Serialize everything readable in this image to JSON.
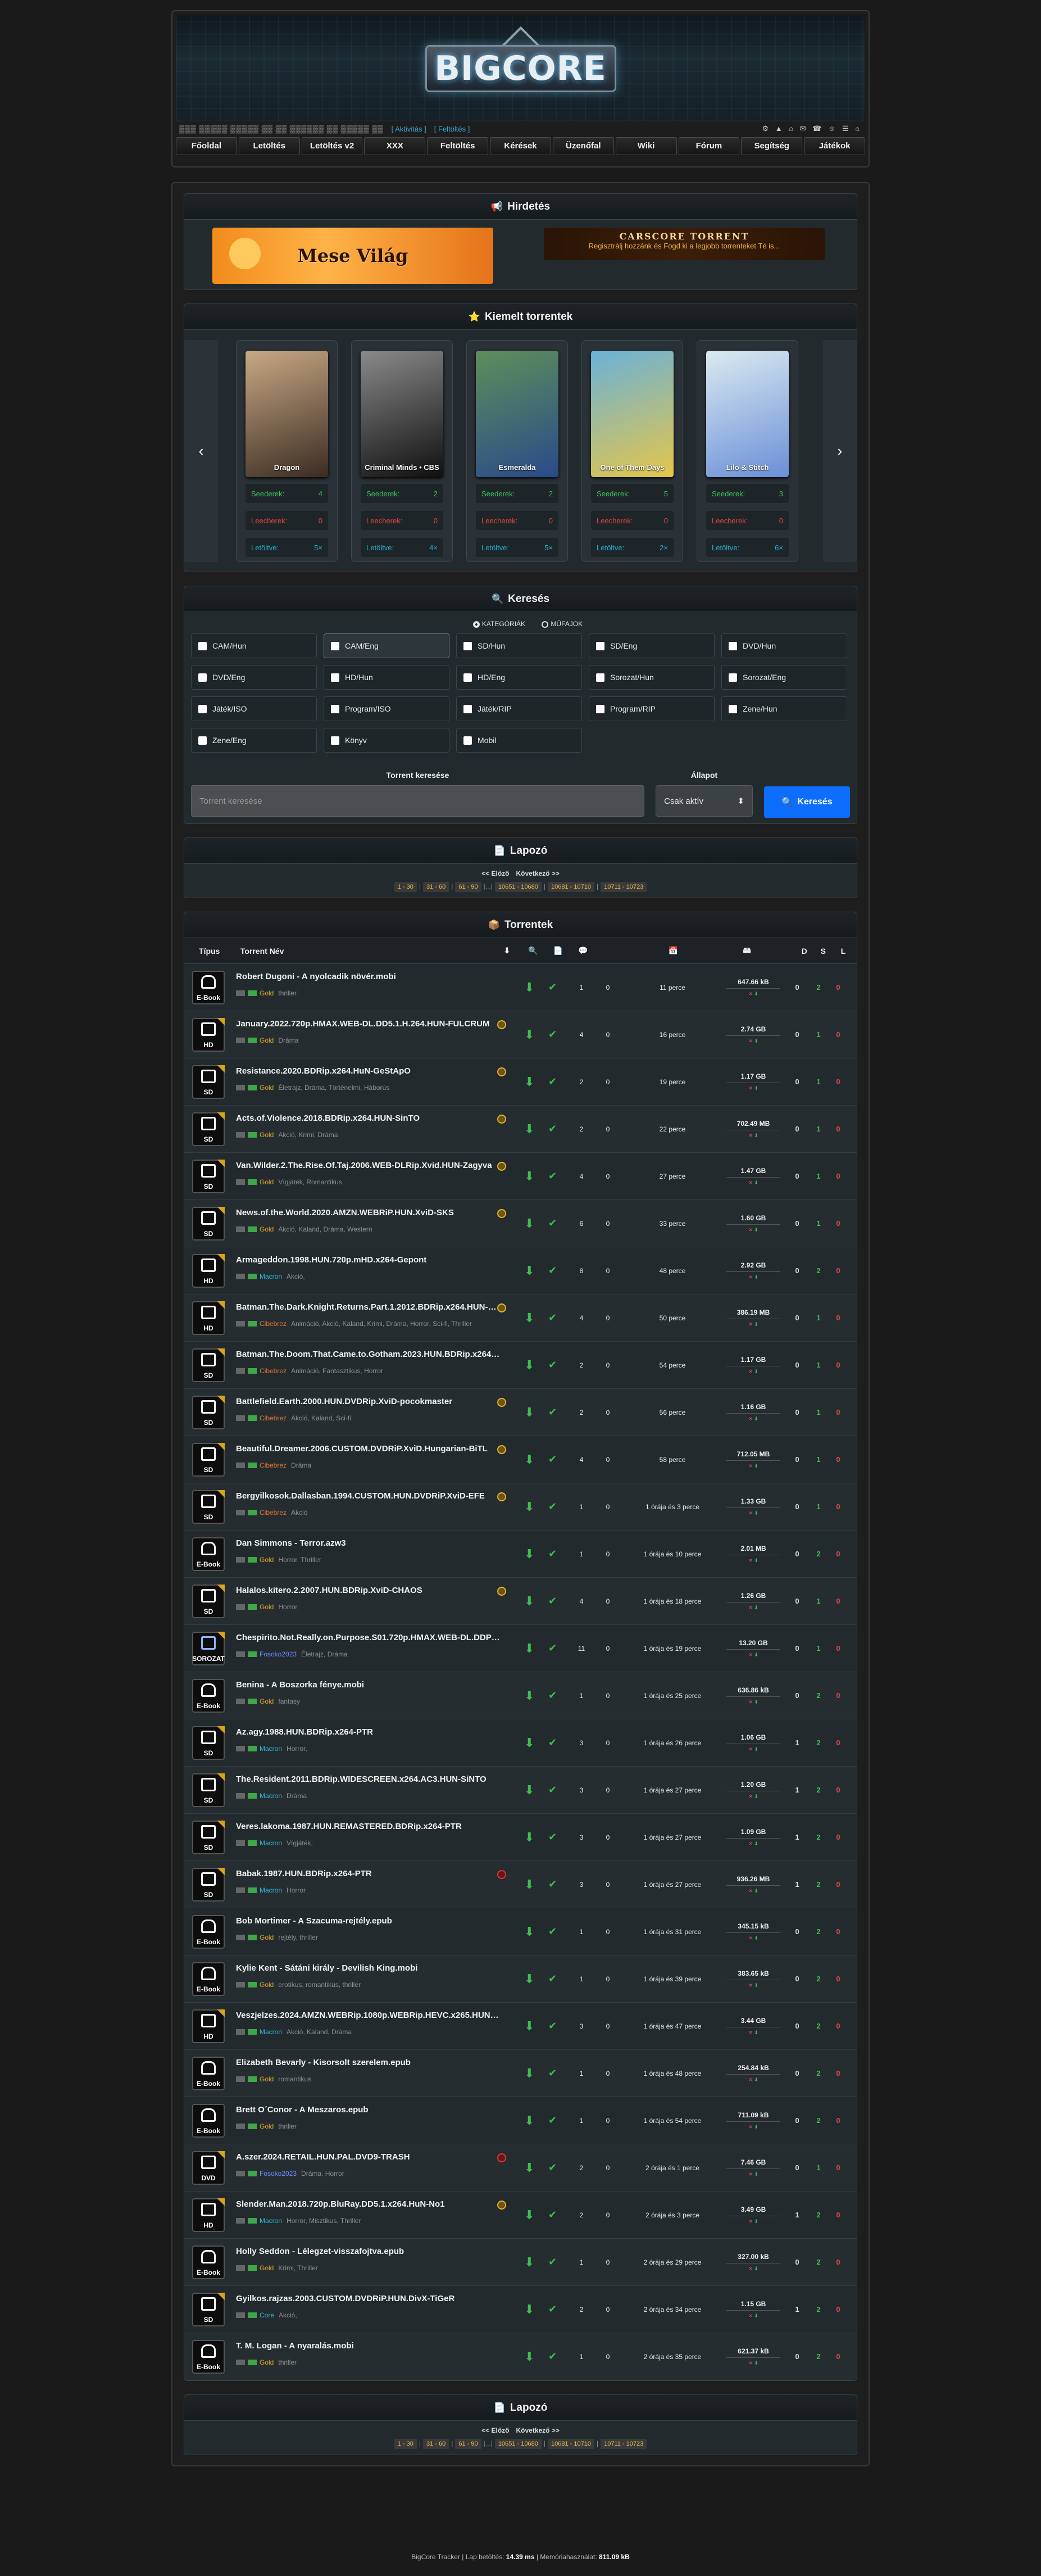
{
  "site": {
    "logo": "BIGCORE",
    "username": "▒▒▒ ▒▒▒▒▒ ▒▒▒▒▒ ▒▒ ▒▒ ▒▒▒▒▒▒ ▒▒ ▒▒▒▒▒ ▒▒",
    "activity_link": "[ Aktivitás ]",
    "topup_link": "[ Feltöltés ]",
    "icons": "⚙ ▲ ⌂ ✉ ☎ ☺ ☰ ⌂"
  },
  "nav": [
    "Főoldal",
    "Letöltés",
    "Letöltés v2",
    "XXX",
    "Feltöltés",
    "Kérések",
    "Üzenőfal",
    "Wiki",
    "Fórum",
    "Segítség",
    "Játékok"
  ],
  "ads": {
    "title": "Hirdetés",
    "ad1": "Mese Világ",
    "ad2_title": "CARSCORE TORRENT",
    "ad2_sub": "Regisztrálj hozzánk és Fogd ki a legjobb torrenteket Té is..."
  },
  "featured": {
    "title": "Kiemelt torrentek",
    "labels": {
      "seed": "Seederek:",
      "leech": "Leecherek:",
      "dl": "Letöltve:"
    },
    "items": [
      {
        "poster": "Dragon",
        "c1": "#c9a985",
        "c2": "#3b2c22",
        "seed": "4",
        "leech": "0",
        "dl": "5×"
      },
      {
        "poster": "Criminal Minds • CBS",
        "c1": "#8a8a8a",
        "c2": "#101010",
        "seed": "2",
        "leech": "0",
        "dl": "4×"
      },
      {
        "poster": "Esmeralda",
        "c1": "#5f8e5a",
        "c2": "#2a4a8a",
        "seed": "2",
        "leech": "0",
        "dl": "5×"
      },
      {
        "poster": "One of Them Days",
        "c1": "#6ab1d9",
        "c2": "#e4c64a",
        "seed": "5",
        "leech": "0",
        "dl": "2×"
      },
      {
        "poster": "Lilo & Stitch",
        "c1": "#dbeaf0",
        "c2": "#6a8fd8",
        "seed": "3",
        "leech": "0",
        "dl": "6×"
      }
    ]
  },
  "search": {
    "title": "Keresés",
    "radio1": "KATEGÓRIÁK",
    "radio2": "MŰFAJOK",
    "categories": [
      "CAM/Hun",
      "CAM/Eng",
      "SD/Hun",
      "SD/Eng",
      "DVD/Hun",
      "DVD/Eng",
      "HD/Hun",
      "HD/Eng",
      "Sorozat/Hun",
      "Sorozat/Eng",
      "Játék/ISO",
      "Program/ISO",
      "Játék/RIP",
      "Program/RIP",
      "Zene/Hun",
      "Zene/Eng",
      "Könyv",
      "Mobil"
    ],
    "query_label": "Torrent keresése",
    "query_placeholder": "Torrent keresése",
    "state_label": "Állapot",
    "state_value": "Csak aktív",
    "button": "Keresés"
  },
  "pager": {
    "title": "Lapozó",
    "prev": "<< Előző",
    "next": "Következő >>",
    "pages": [
      "1 - 30",
      "31 - 60",
      "61 - 90",
      "...",
      "10651 - 10680",
      "10681 - 10710",
      "10711 - 10723"
    ]
  },
  "torrents": {
    "title": "Torrentek",
    "col_type": "Típus",
    "col_name": "Torrent Név",
    "col_d": "D",
    "col_s": "S",
    "col_l": "L",
    "rows": [
      {
        "cat": "E-Book",
        "name": "Robert Dugoni - A nyolcadik növér.mobi",
        "uploader": "Gold",
        "uc": "u-gold",
        "genre": "thriller",
        "badge": "",
        "c": "1",
        "m": "0",
        "time": "11 perce",
        "size": "647.66 kB",
        "d": "0",
        "s": "2",
        "l": "0"
      },
      {
        "cat": "HD",
        "name": "January.2022.720p.HMAX.WEB-DL.DD5.1.H.264.HUN-FULCRUM",
        "uploader": "Gold",
        "uc": "u-gold",
        "genre": "Dráma",
        "badge": "y",
        "c": "4",
        "m": "0",
        "time": "16 perce",
        "size": "2.74 GB",
        "d": "0",
        "s": "1",
        "l": "0"
      },
      {
        "cat": "SD",
        "name": "Resistance.2020.BDRip.x264.HuN-GeStApO",
        "uploader": "Gold",
        "uc": "u-gold",
        "genre": "Életrajz, Dráma, Történelmi, Háborús",
        "badge": "y",
        "c": "2",
        "m": "0",
        "time": "19 perce",
        "size": "1.17 GB",
        "d": "0",
        "s": "1",
        "l": "0"
      },
      {
        "cat": "SD",
        "name": "Acts.of.Violence.2018.BDRip.x264.HUN-SinTO",
        "uploader": "Gold",
        "uc": "u-gold",
        "genre": "Akció, Krimi, Dráma",
        "badge": "y",
        "c": "2",
        "m": "0",
        "time": "22 perce",
        "size": "702.49 MB",
        "d": "0",
        "s": "1",
        "l": "0"
      },
      {
        "cat": "SD",
        "name": "Van.Wilder.2.The.Rise.Of.Taj.2006.WEB-DLRip.Xvid.HUN-Zagyva",
        "uploader": "Gold",
        "uc": "u-gold",
        "genre": "Vígjáték, Romantikus",
        "badge": "y",
        "c": "4",
        "m": "0",
        "time": "27 perce",
        "size": "1.47 GB",
        "d": "0",
        "s": "1",
        "l": "0"
      },
      {
        "cat": "SD",
        "name": "News.of.the.World.2020.AMZN.WEBRiP.HUN.XviD-SKS",
        "uploader": "Gold",
        "uc": "u-gold",
        "genre": "Akció, Kaland, Dráma, Western",
        "badge": "y",
        "c": "6",
        "m": "0",
        "time": "33 perce",
        "size": "1.60 GB",
        "d": "0",
        "s": "1",
        "l": "0"
      },
      {
        "cat": "HD",
        "name": "Armageddon.1998.HUN.720p.mHD.x264-Gepont",
        "uploader": "Macron",
        "uc": "u-mac",
        "genre": "Akció,",
        "badge": "",
        "c": "8",
        "m": "0",
        "time": "48 perce",
        "size": "2.92 GB",
        "d": "0",
        "s": "2",
        "l": "0"
      },
      {
        "cat": "HD",
        "name": "Batman.The.Dark.Knight.Returns.Part.1.2012.BDRip.x264.HUN-PROD",
        "uploader": "Cibebrez",
        "uc": "u-cib",
        "genre": "Animáció, Akció, Kaland, Krimi, Dráma, Horror, Sci-fi, Thriller",
        "badge": "y",
        "c": "4",
        "m": "0",
        "time": "50 perce",
        "size": "386.19 MB",
        "d": "0",
        "s": "1",
        "l": "0"
      },
      {
        "cat": "SD",
        "name": "Batman.The.Doom.That.Came.to.Gotham.2023.HUN.BDRip.x264-PROD",
        "uploader": "Cibebrez",
        "uc": "u-cib",
        "genre": "Animáció, Fantasztikus, Horror",
        "badge": "",
        "c": "2",
        "m": "0",
        "time": "54 perce",
        "size": "1.17 GB",
        "d": "0",
        "s": "1",
        "l": "0"
      },
      {
        "cat": "SD",
        "name": "Battlefield.Earth.2000.HUN.DVDRip.XviD-pocokmaster",
        "uploader": "Cibebrez",
        "uc": "u-cib",
        "genre": "Akció, Kaland, Sci-fi",
        "badge": "y",
        "c": "2",
        "m": "0",
        "time": "56 perce",
        "size": "1.16 GB",
        "d": "0",
        "s": "1",
        "l": "0"
      },
      {
        "cat": "SD",
        "name": "Beautiful.Dreamer.2006.CUSTOM.DVDRiP.XviD.Hungarian-BiTL",
        "uploader": "Cibebrez",
        "uc": "u-cib",
        "genre": "Dráma",
        "badge": "y",
        "c": "4",
        "m": "0",
        "time": "58 perce",
        "size": "712.05 MB",
        "d": "0",
        "s": "1",
        "l": "0"
      },
      {
        "cat": "SD",
        "name": "Bergyilkosok.Dallasban.1994.CUSTOM.HUN.DVDRiP.XviD-EFE",
        "uploader": "Cibebrez",
        "uc": "u-cib",
        "genre": "Akció",
        "badge": "y",
        "c": "1",
        "m": "0",
        "time": "1 órája és 3 perce",
        "size": "1.33 GB",
        "d": "0",
        "s": "1",
        "l": "0"
      },
      {
        "cat": "E-Book",
        "name": "Dan Simmons - Terror.azw3",
        "uploader": "Gold",
        "uc": "u-gold",
        "genre": "Horror, Thriller",
        "badge": "",
        "c": "1",
        "m": "0",
        "time": "1 órája és 10 perce",
        "size": "2.01 MB",
        "d": "0",
        "s": "2",
        "l": "0"
      },
      {
        "cat": "SD",
        "name": "Halalos.kitero.2.2007.HUN.BDRip.XviD-CHAOS",
        "uploader": "Gold",
        "uc": "u-gold",
        "genre": "Horror",
        "badge": "y",
        "c": "4",
        "m": "0",
        "time": "1 órája és 18 perce",
        "size": "1.26 GB",
        "d": "0",
        "s": "1",
        "l": "0"
      },
      {
        "cat": "SOROZAT",
        "name": "Chespirito.Not.Really.on.Purpose.S01.720p.HMAX.WEB-DL.DDP5.1",
        "uploader": "Fosoko2023",
        "uc": "u-fel",
        "genre": "Életrajz, Dráma",
        "badge": "",
        "c": "11",
        "m": "0",
        "time": "1 órája és 19 perce",
        "size": "13.20 GB",
        "d": "0",
        "s": "1",
        "l": "0"
      },
      {
        "cat": "E-Book",
        "name": "Benina - A Boszorka fénye.mobi",
        "uploader": "Gold",
        "uc": "u-gold",
        "genre": "fantasy",
        "badge": "",
        "c": "1",
        "m": "0",
        "time": "1 órája és 25 perce",
        "size": "636.86 kB",
        "d": "0",
        "s": "2",
        "l": "0"
      },
      {
        "cat": "SD",
        "name": "Az.agy.1988.HUN.BDRip.x264-PTR",
        "uploader": "Macron",
        "uc": "u-mac",
        "genre": "Horror,",
        "badge": "",
        "c": "3",
        "m": "0",
        "time": "1 órája és 26 perce",
        "size": "1.06 GB",
        "d": "1",
        "s": "2",
        "l": "0"
      },
      {
        "cat": "SD",
        "name": "The.Resident.2011.BDRip.WIDESCREEN.x264.AC3.HUN-SiNTO",
        "uploader": "Macron",
        "uc": "u-mac",
        "genre": "Dráma",
        "badge": "",
        "c": "3",
        "m": "0",
        "time": "1 órája és 27 perce",
        "size": "1.20 GB",
        "d": "1",
        "s": "2",
        "l": "0"
      },
      {
        "cat": "SD",
        "name": "Veres.lakoma.1987.HUN.REMASTERED.BDRip.x264-PTR",
        "uploader": "Macron",
        "uc": "u-mac",
        "genre": "Vígjáték,",
        "badge": "",
        "c": "3",
        "m": "0",
        "time": "1 órája és 27 perce",
        "size": "1.09 GB",
        "d": "1",
        "s": "2",
        "l": "0"
      },
      {
        "cat": "SD",
        "name": "Babak.1987.HUN.BDRip.x264-PTR",
        "uploader": "Macron",
        "uc": "u-mac",
        "genre": "Horror",
        "badge": "r",
        "c": "3",
        "m": "0",
        "time": "1 órája és 27 perce",
        "size": "936.26 MB",
        "d": "1",
        "s": "2",
        "l": "0"
      },
      {
        "cat": "E-Book",
        "name": "Bob Mortimer - A Szacuma-rejtély.epub",
        "uploader": "Gold",
        "uc": "u-gold",
        "genre": "rejtély, thriller",
        "badge": "",
        "c": "1",
        "m": "0",
        "time": "1 órája és 31 perce",
        "size": "345.15 kB",
        "d": "0",
        "s": "2",
        "l": "0"
      },
      {
        "cat": "E-Book",
        "name": "Kylie Kent - Sátáni király - Devilish King.mobi",
        "uploader": "Gold",
        "uc": "u-gold",
        "genre": "erotikus, romantikus, thriller",
        "badge": "",
        "c": "1",
        "m": "0",
        "time": "1 órája és 39 perce",
        "size": "383.65 kB",
        "d": "0",
        "s": "2",
        "l": "0"
      },
      {
        "cat": "HD",
        "name": "Veszjelzes.2024.AMZN.WEBRip.1080p.WEBRip.HEVC.x265.HUN-GS88",
        "uploader": "Macron",
        "uc": "u-mac",
        "genre": "Akció, Kaland, Dráma",
        "badge": "",
        "c": "3",
        "m": "0",
        "time": "1 órája és 47 perce",
        "size": "3.44 GB",
        "d": "0",
        "s": "2",
        "l": "0"
      },
      {
        "cat": "E-Book",
        "name": "Elizabeth Bevarly - Kisorsolt szerelem.epub",
        "uploader": "Gold",
        "uc": "u-gold",
        "genre": "romantikus",
        "badge": "",
        "c": "1",
        "m": "0",
        "time": "1 órája és 48 perce",
        "size": "254.84 kB",
        "d": "0",
        "s": "2",
        "l": "0"
      },
      {
        "cat": "E-Book",
        "name": "Brett O´Conor - A Meszaros.epub",
        "uploader": "Gold",
        "uc": "u-gold",
        "genre": "thriller",
        "badge": "",
        "c": "1",
        "m": "0",
        "time": "1 órája és 54 perce",
        "size": "711.09 kB",
        "d": "0",
        "s": "2",
        "l": "0"
      },
      {
        "cat": "DVD",
        "name": "A.szer.2024.RETAIL.HUN.PAL.DVD9-TRASH",
        "uploader": "Fosoko2023",
        "uc": "u-fel",
        "genre": "Dráma, Horror",
        "badge": "r",
        "c": "2",
        "m": "0",
        "time": "2 órája és 1 perce",
        "size": "7.46 GB",
        "d": "0",
        "s": "1",
        "l": "0"
      },
      {
        "cat": "HD",
        "name": "Slender.Man.2018.720p.BluRay.DD5.1.x264.HuN-No1",
        "uploader": "Macron",
        "uc": "u-mac",
        "genre": "Horror, Misztikus, Thriller",
        "badge": "y",
        "c": "2",
        "m": "0",
        "time": "2 órája és 3 perce",
        "size": "3.49 GB",
        "d": "1",
        "s": "2",
        "l": "0"
      },
      {
        "cat": "E-Book",
        "name": "Holly Seddon - Lélegzet-visszafojtva.epub",
        "uploader": "Gold",
        "uc": "u-gold",
        "genre": "Krimi, Thriller",
        "badge": "",
        "c": "1",
        "m": "0",
        "time": "2 órája és 29 perce",
        "size": "327.00 kB",
        "d": "0",
        "s": "2",
        "l": "0"
      },
      {
        "cat": "SD",
        "name": "Gyilkos.rajzas.2003.CUSTOM.DVDRiP.HUN.DivX-TiGeR",
        "uploader": "Core",
        "uc": "u-core",
        "genre": "Akció,",
        "badge": "",
        "c": "2",
        "m": "0",
        "time": "2 órája és 34 perce",
        "size": "1.15 GB",
        "d": "1",
        "s": "2",
        "l": "0"
      },
      {
        "cat": "E-Book",
        "name": "T. M. Logan - A nyaralás.mobi",
        "uploader": "Gold",
        "uc": "u-gold",
        "genre": "thriller",
        "badge": "",
        "c": "1",
        "m": "0",
        "time": "2 órája és 35 perce",
        "size": "621.37 kB",
        "d": "0",
        "s": "2",
        "l": "0"
      }
    ]
  },
  "footer": {
    "prefix": "BigCore Tracker | Lap betöltés: ",
    "load": "14.39 ms",
    "mid": " | Memóriahasználat: ",
    "mem": "811.09 kB"
  }
}
